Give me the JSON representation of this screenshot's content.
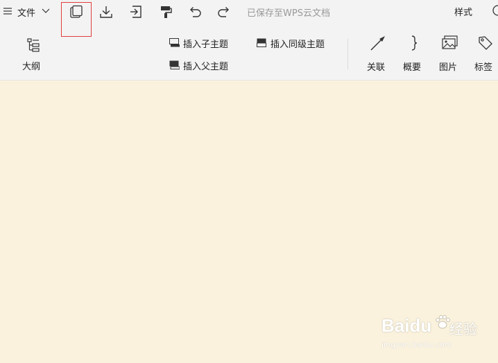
{
  "menu": {
    "file_label": "文件"
  },
  "toolbar": {
    "save_status": "已保存至WPS云文档",
    "style_label": "样式",
    "outline_label": "大纲",
    "insert_child_label": "插入子主题",
    "insert_sibling_label": "插入同级主题",
    "insert_parent_label": "插入父主题",
    "relation_label": "关联",
    "summary_label": "概要",
    "image_label": "图片",
    "tag_label": "标签"
  },
  "watermark": {
    "brand": "Baidu",
    "brand_cn": "经验",
    "url": "jingyan.baidu.com"
  },
  "colors": {
    "toolbar_bg": "#f3f3f3",
    "canvas_bg": "#faf2dd",
    "highlight_border": "#e13c3c"
  }
}
